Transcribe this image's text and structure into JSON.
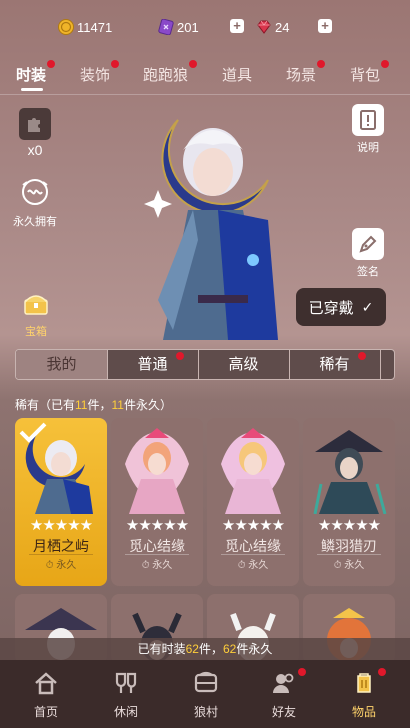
{
  "currency": {
    "gold": "11471",
    "tickets": "201",
    "gems": "24"
  },
  "top_tabs": [
    {
      "label": "时装",
      "dot": true
    },
    {
      "label": "装饰",
      "dot": true
    },
    {
      "label": "跑跑狼",
      "dot": true
    },
    {
      "label": "道具",
      "dot": false
    },
    {
      "label": "场景",
      "dot": true
    },
    {
      "label": "背包",
      "dot": true
    }
  ],
  "stage": {
    "puzzle_count": "x0",
    "permanent_label": "永久拥有",
    "chest_label": "宝箱",
    "info_label": "说明",
    "sign_label": "签名",
    "worn_label": "已穿戴"
  },
  "rarity_tabs": [
    {
      "label": "我的",
      "dot": false
    },
    {
      "label": "普通",
      "dot": true
    },
    {
      "label": "高级",
      "dot": false
    },
    {
      "label": "稀有",
      "dot": true
    }
  ],
  "owned": {
    "prefix": "稀有（已有",
    "count": "11",
    "mid": "件，",
    "perm": "11",
    "suffix": "件永久）"
  },
  "cards": [
    {
      "name": "月栖之屿",
      "stars": "★★★★★",
      "perm": "永久",
      "selected": true
    },
    {
      "name": "觅心结缘",
      "stars": "★★★★★",
      "perm": "永久",
      "selected": false
    },
    {
      "name": "觅心结缘",
      "stars": "★★★★★",
      "perm": "永久",
      "selected": false
    },
    {
      "name": "鳞羽猎刃",
      "stars": "★★★★★",
      "perm": "永久",
      "selected": false
    }
  ],
  "collection": {
    "prefix": "已有时装",
    "count": "62",
    "mid": "件，",
    "perm": "62",
    "suffix": "件永久"
  },
  "bottom_nav": [
    {
      "label": "首页",
      "icon": "home-icon",
      "dot": false
    },
    {
      "label": "休闲",
      "icon": "leisure-icon",
      "dot": false
    },
    {
      "label": "狼村",
      "icon": "village-icon",
      "dot": false
    },
    {
      "label": "好友",
      "icon": "friends-icon",
      "dot": true
    },
    {
      "label": "物品",
      "icon": "items-icon",
      "dot": true
    }
  ],
  "colors": {
    "accent_gold": "#ffcf3a",
    "notification_red": "#e0182b",
    "nav_bg": "#3b2b2a"
  }
}
